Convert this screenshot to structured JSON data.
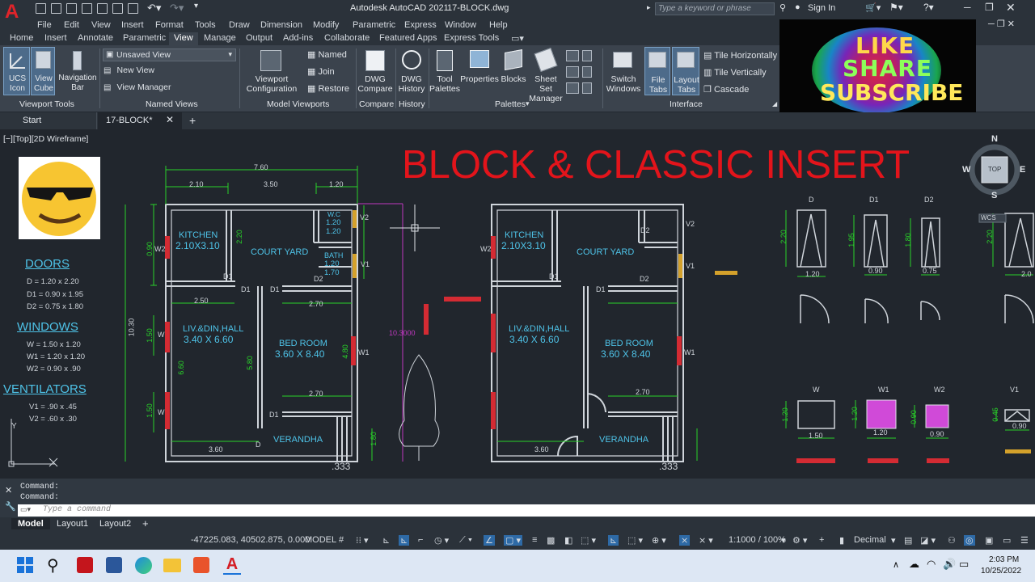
{
  "title_bar": {
    "app_title": "Autodesk AutoCAD 2021",
    "file_title": "17-BLOCK.dwg",
    "search_placeholder": "Type a keyword or phrase",
    "sign_in": "Sign In"
  },
  "menu": [
    "File",
    "Edit",
    "View",
    "Insert",
    "Format",
    "Tools",
    "Draw",
    "Dimension",
    "Modify",
    "Parametric",
    "Express",
    "Window",
    "Help"
  ],
  "ribbon_tabs": [
    "Home",
    "Insert",
    "Annotate",
    "Parametric",
    "View",
    "Manage",
    "Output",
    "Add-ins",
    "Collaborate",
    "Featured Apps",
    "Express Tools"
  ],
  "ribbon_active_tab": "View",
  "ribbon": {
    "ucs_icon": "UCS Icon",
    "view_cube": "View Cube",
    "navigation_bar": "Navigation Bar",
    "viewport_tools": "Viewport Tools",
    "unsaved_view": "Unsaved View",
    "new_view": "New View",
    "view_manager": "View Manager",
    "named_views": "Named Views",
    "viewport_configuration": "Viewport Configuration",
    "named": "Named",
    "join": "Join",
    "restore": "Restore",
    "model_viewports": "Model Viewports",
    "dwg_compare": "DWG Compare",
    "compare": "Compare",
    "dwg_history": "DWG History",
    "history": "History",
    "tool_palettes": "Tool Palettes",
    "properties": "Properties",
    "blocks": "Blocks",
    "sheet_set_manager": "Sheet Set Manager",
    "palettes": "Palettes",
    "switch_windows": "Switch Windows",
    "file_tabs": "File Tabs",
    "layout_tabs": "Layout Tabs",
    "tile_horizontally": "Tile Horizontally",
    "tile_vertically": "Tile Vertically",
    "cascade": "Cascade",
    "interface": "Interface"
  },
  "thumbnail": {
    "line1": "LIKE",
    "line2": "SHARE",
    "line3": "SUBSCRIBE"
  },
  "file_tabs": {
    "start": "Start",
    "current": "17-BLOCK*"
  },
  "viewport_label": "[−][Top][2D Wireframe]",
  "banner_title": "BLOCK & CLASSIC INSERT",
  "legend": {
    "doors_title": "DOORS",
    "doors": [
      "D = 1.20 x 2.20",
      "D1 = 0.90 x 1.95",
      "D2 = 0.75 x 1.80"
    ],
    "windows_title": "WINDOWS",
    "windows": [
      "W = 1.50 x 1.20",
      "W1 = 1.20 x 1.20",
      "W2 = 0.90 x .90"
    ],
    "ventilators_title": "VENTILATORS",
    "ventilators": [
      "V1 = .90 x .45",
      "V2 = .60 x .30"
    ]
  },
  "plan": {
    "kitchen": "KITCHEN",
    "kitchen_size": "2.10X3.10",
    "court_yard": "COURT YARD",
    "wc": "W.C",
    "wc_size1": "1.20",
    "wc_size2": "1.20",
    "bath": "BATH",
    "bath_size1": "1.20",
    "bath_size2": "1.70",
    "liv": "LIV.&DIN,HALL",
    "liv_size": "3.40 X 6.60",
    "bed": "BED ROOM",
    "bed_size": "3.60 X 8.40",
    "verandha": "VERANDHA",
    "dims": {
      "total": "7.60",
      "d210": "2.10",
      "d350": "3.50",
      "d120": "1.20",
      "d250": "2.50",
      "d270": "2.70",
      "d270b": "2.70",
      "d360": "3.60",
      "d1030": "10.30",
      "d1030b": "10.3000",
      "d660": "6.60",
      "d580": "5.80",
      "d480": "4.80",
      "d180": "1.80",
      "d150": "1.50",
      "d150b": "1.50",
      "d090": "0.90",
      "d220": "2.20",
      "d333": ".333"
    },
    "tags": {
      "w": "W",
      "w1": "W1",
      "w2": "W2",
      "d": "D",
      "d1": "D1",
      "d2": "D2",
      "v1": "V1",
      "v2": "V2"
    }
  },
  "blocks": {
    "doors": [
      "D",
      "D1",
      "D2"
    ],
    "door_heights": [
      "2.20",
      "1.95",
      "1.80",
      "2.20"
    ],
    "door_widths": [
      "1.20",
      "0.90",
      "0.75",
      "2.0"
    ],
    "windows": [
      "W",
      "W1",
      "W2",
      "V1"
    ],
    "window_heights": [
      "1.20",
      "1.20",
      "0.90",
      "0.45"
    ],
    "window_widths": [
      "1.50",
      "1.20",
      "0.90",
      "0.90"
    ],
    "wcs": "WCS"
  },
  "viewcube": {
    "n": "N",
    "s": "S",
    "e": "E",
    "w": "W",
    "top": "TOP"
  },
  "command": {
    "line1": "Command:",
    "line2": "Command:",
    "placeholder": "Type a command"
  },
  "layout_tabs": [
    "Model",
    "Layout1",
    "Layout2"
  ],
  "status": {
    "coords": "-47225.083, 40502.875, 0.000",
    "model": "MODEL",
    "scale": "1:1000 / 100%",
    "units": "Decimal"
  },
  "taskbar": {
    "time": "2:03 PM",
    "date": "10/25/2022"
  },
  "colors": {
    "accent": "#2e6aa6",
    "dimension": "#29d329",
    "room_text": "#4ec3e8",
    "banner": "#e3141b",
    "window": "#d42b33",
    "ventilator": "#d4a12b"
  }
}
